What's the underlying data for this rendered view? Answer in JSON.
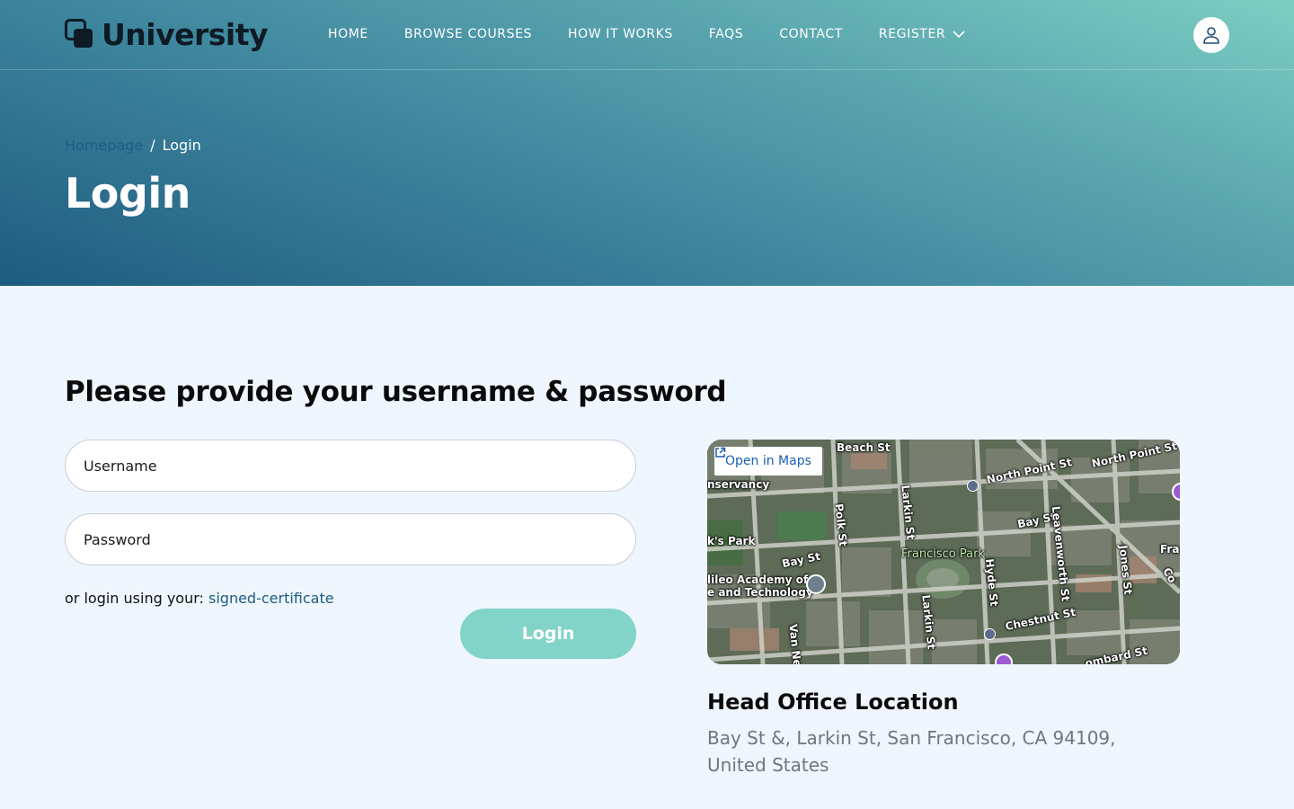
{
  "header": {
    "brand": "University",
    "nav": [
      {
        "label": "HOME"
      },
      {
        "label": "BROWSE COURSES"
      },
      {
        "label": "HOW IT WORKS"
      },
      {
        "label": "FAQS"
      },
      {
        "label": "CONTACT"
      },
      {
        "label": "REGISTER",
        "has_dropdown": true
      }
    ],
    "user_icon": "user-icon"
  },
  "hero": {
    "breadcrumb": {
      "home": "Homepage",
      "separator": "/",
      "current": "Login"
    },
    "title": "Login"
  },
  "login": {
    "heading": "Please provide your username & password",
    "username_placeholder": "Username",
    "password_placeholder": "Password",
    "alt_prefix": "or login using your:",
    "alt_link": "signed-certificate",
    "submit_label": "Login"
  },
  "map": {
    "open_label": "Open in Maps",
    "labels": {
      "beach_st": "Beach St",
      "north_point_1": "North Point St",
      "north_point_2": "North Point St",
      "conservancy": "nservancy",
      "polk_st": "Polk St",
      "larkin_1": "Larkin St",
      "bay_st_1": "Bay St",
      "bay_st_2": "Bay St",
      "leavenworth": "Leavenworth St",
      "jones_st": "Jones St",
      "park_left": "k's Park",
      "francisco_park": "Francisco Park",
      "hyde_st": "Hyde St",
      "academy_1": "lileo Academy of",
      "academy_2": "e and Technology",
      "larkin_2": "Larkin St",
      "chestnut": "Chestnut St",
      "van_ness": "Van Ne",
      "lombard": "ombard St",
      "fra": "Fra",
      "col": "Co"
    }
  },
  "office": {
    "title": "Head Office Location",
    "address": "Bay St &, Larkin St, San Francisco, CA 94109, United States"
  },
  "colors": {
    "accent_teal": "#82d3c8",
    "link_blue": "#1b5b82",
    "hero_dark": "#1f5b7f",
    "hero_light": "#7ccec2",
    "page_bg": "#eff6fd"
  }
}
